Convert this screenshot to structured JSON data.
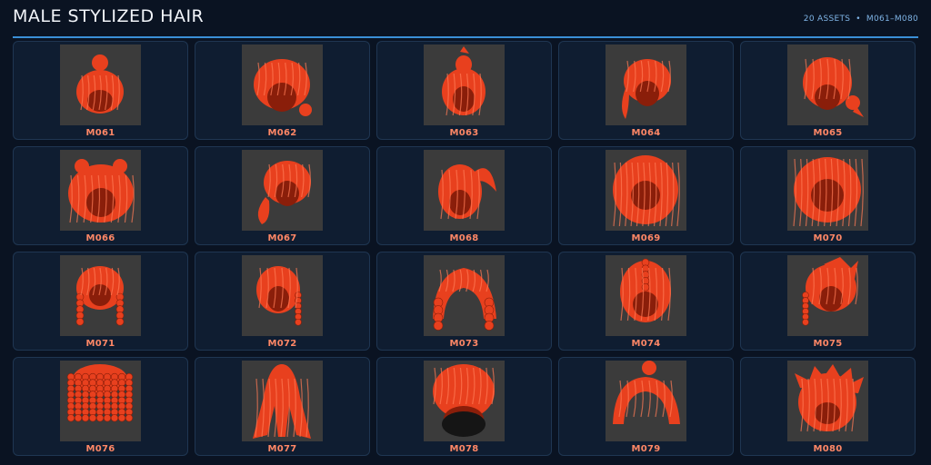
{
  "header": {
    "title": "MALE STYLIZED HAIR",
    "asset_count": "20 ASSETS",
    "range": "M061–M080"
  },
  "colors": {
    "background": "#0a1322",
    "card": "#0f1d31",
    "accent_line": "#3a8fd6",
    "hair": "#e8401e",
    "label": "#ff8766"
  },
  "assets": [
    {
      "code": "M061",
      "icon": "top-bun-hair-icon"
    },
    {
      "code": "M062",
      "icon": "swept-hair-low-bun-icon"
    },
    {
      "code": "M063",
      "icon": "spiky-topknot-hair-icon"
    },
    {
      "code": "M064",
      "icon": "windswept-ponytail-hair-icon"
    },
    {
      "code": "M065",
      "icon": "messy-hair-side-bun-icon"
    },
    {
      "code": "M066",
      "icon": "double-bun-hair-icon"
    },
    {
      "code": "M067",
      "icon": "side-ponytail-hair-icon"
    },
    {
      "code": "M068",
      "icon": "high-ponytail-hair-icon"
    },
    {
      "code": "M069",
      "icon": "wavy-long-hair-icon"
    },
    {
      "code": "M070",
      "icon": "shaggy-layered-hair-icon"
    },
    {
      "code": "M071",
      "icon": "braided-sides-hair-icon"
    },
    {
      "code": "M072",
      "icon": "single-braid-hair-icon"
    },
    {
      "code": "M073",
      "icon": "cornrow-braids-hair-icon"
    },
    {
      "code": "M074",
      "icon": "braided-crown-hair-icon"
    },
    {
      "code": "M075",
      "icon": "spiky-side-braid-hair-icon"
    },
    {
      "code": "M076",
      "icon": "twisted-locs-hair-icon"
    },
    {
      "code": "M077",
      "icon": "long-straight-hair-icon"
    },
    {
      "code": "M078",
      "icon": "voluminous-curly-hair-icon"
    },
    {
      "code": "M079",
      "icon": "middle-part-bun-hair-icon"
    },
    {
      "code": "M080",
      "icon": "spiky-textured-hair-icon"
    }
  ]
}
